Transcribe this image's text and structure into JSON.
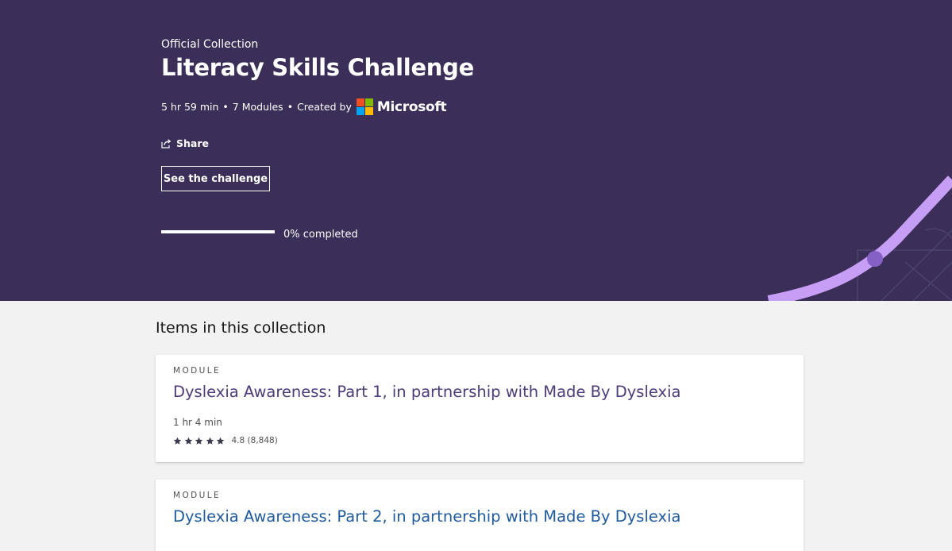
{
  "hero": {
    "kicker": "Official Collection",
    "title": "Literacy Skills Challenge",
    "meta": {
      "duration": "5 hr 59 min",
      "separator": "•",
      "modules": "7 Modules",
      "created_by_label": "Created by",
      "creator": "Microsoft"
    },
    "share_label": "Share",
    "challenge_button": "See the challenge",
    "progress": {
      "label": "0% completed",
      "fraction": 0
    }
  },
  "colors": {
    "hero_bg": "#3b2e58",
    "accent_line": "#c69ef5",
    "accent_dot": "#8661c5",
    "card_title_1": "#4d3b7a",
    "card_title_2": "#1f5b9e",
    "ms_red": "#f25022",
    "ms_green": "#7fba00",
    "ms_blue": "#00a4ef",
    "ms_yellow": "#ffb900"
  },
  "collection": {
    "heading": "Items in this collection",
    "items": [
      {
        "type": "MODULE",
        "title": "Dyslexia Awareness: Part 1, in partnership with Made By Dyslexia",
        "duration": "1 hr 4 min",
        "rating": "4.8 (8,848)",
        "stars": 5
      },
      {
        "type": "MODULE",
        "title": "Dyslexia Awareness: Part 2, in partnership with Made By Dyslexia"
      }
    ]
  }
}
